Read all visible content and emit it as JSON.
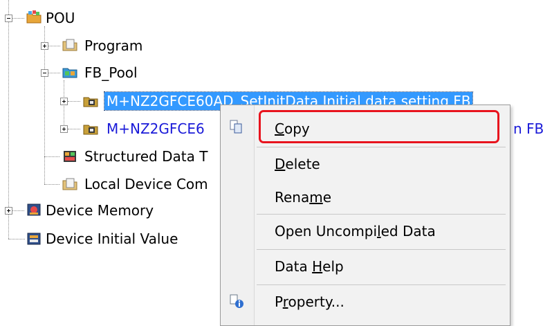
{
  "tree": {
    "pou": "POU",
    "program": "Program",
    "fb_pool": "FB_Pool",
    "fb1": "M+NZ2GFCE60AD_SetInitData Initial data setting FB",
    "fb2_start": "M+NZ2GFCE6",
    "fb2_end": "n FB",
    "structured_data": "Structured Data T",
    "local_device": "Local Device Com",
    "device_memory": "Device Memory",
    "device_initial": "Device Initial Value"
  },
  "menu": {
    "copy": {
      "m": "C",
      "rest": "opy"
    },
    "delete": {
      "m": "D",
      "rest": "elete"
    },
    "rename": {
      "pre": "Rena",
      "m": "m",
      "rest": "e"
    },
    "open": {
      "pre": "Open Uncompi",
      "m": "l",
      "rest": "ed Data"
    },
    "help": {
      "pre": "Data ",
      "m": "H",
      "rest": "elp"
    },
    "property": {
      "pre": "P",
      "m": "r",
      "rest": "operty..."
    }
  },
  "colors": {
    "selection": "#3399ff",
    "fb_text": "#1a1ad8",
    "highlight_border": "#e8141e"
  },
  "icons": {
    "pou": "pou-folder-icon",
    "program": "program-folder-icon",
    "fb_pool": "fb-pool-icon",
    "fb": "function-block-icon",
    "structured": "structured-data-icon",
    "local": "local-device-icon",
    "memory": "device-memory-icon",
    "initial": "device-initial-icon",
    "copy": "copy-icon",
    "property": "property-icon"
  }
}
